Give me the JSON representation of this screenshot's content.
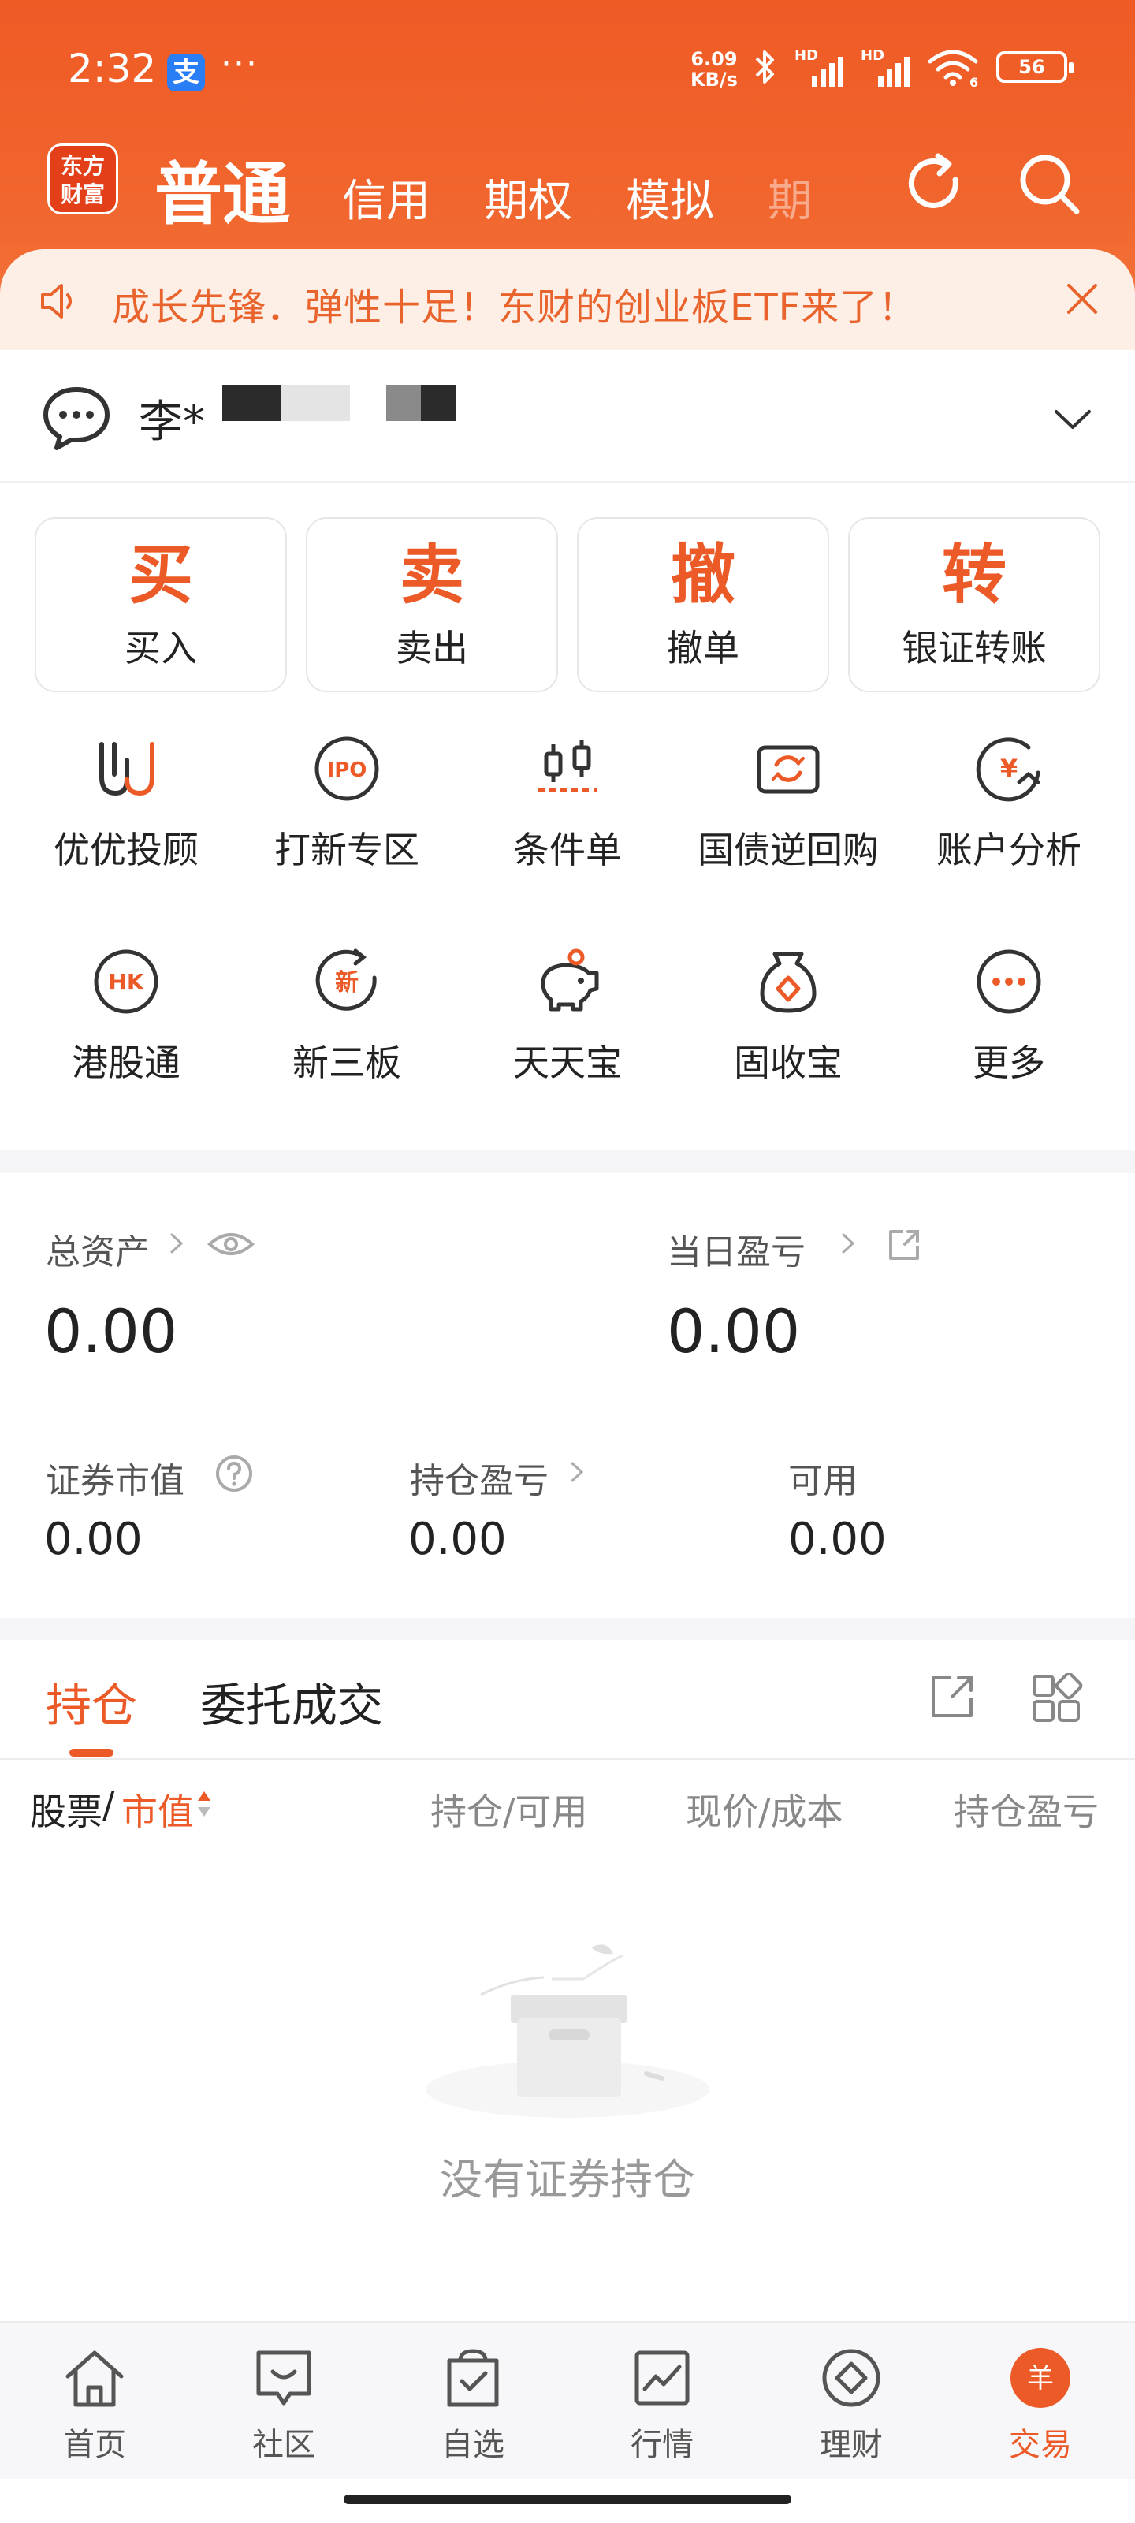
{
  "status_bar": {
    "time": "2:32",
    "app_badge": "支",
    "more": "···",
    "net_speed_value": "6.09",
    "net_speed_unit": "KB/s",
    "signal_1": "HD",
    "signal_2": "HD",
    "wifi_badge": "6",
    "battery": "56"
  },
  "header": {
    "brand": "东方财富",
    "brand_line1": "东方",
    "brand_line2": "财富",
    "tabs": [
      "普通",
      "信用",
      "期权",
      "模拟",
      "期"
    ],
    "active_tab": "普通"
  },
  "notice": {
    "text": "成长先锋．弹性十足！东财的创业板ETF来了！"
  },
  "account": {
    "name": "李*"
  },
  "main_actions": [
    {
      "big": "买",
      "label": "买入"
    },
    {
      "big": "卖",
      "label": "卖出"
    },
    {
      "big": "撤",
      "label": "撤单"
    },
    {
      "big": "转",
      "label": "银证转账"
    }
  ],
  "functions": [
    {
      "label": "优优投顾",
      "icon": "uu-advisor-icon"
    },
    {
      "label": "打新专区",
      "icon": "ipo-icon",
      "icon_text": "IPO"
    },
    {
      "label": "条件单",
      "icon": "condition-order-icon"
    },
    {
      "label": "国债逆回购",
      "icon": "bond-repo-icon"
    },
    {
      "label": "账户分析",
      "icon": "account-analysis-icon",
      "icon_text": "¥"
    },
    {
      "label": "港股通",
      "icon": "hk-connect-icon",
      "icon_text": "HK"
    },
    {
      "label": "新三板",
      "icon": "new-third-board-icon",
      "icon_text": "新"
    },
    {
      "label": "天天宝",
      "icon": "piggy-bank-icon"
    },
    {
      "label": "固收宝",
      "icon": "money-bag-icon"
    },
    {
      "label": "更多",
      "icon": "more-icon"
    }
  ],
  "assets": {
    "total_label": "总资产",
    "total_value": "0.00",
    "daily_pl_label": "当日盈亏",
    "daily_pl_value": "0.00",
    "market_value_label": "证券市值",
    "market_value": "0.00",
    "position_pl_label": "持仓盈亏",
    "position_pl_value": "0.00",
    "available_label": "可用",
    "available_value": "0.00"
  },
  "positions": {
    "tabs": [
      "持仓",
      "委托成交"
    ],
    "columns": {
      "stock": "股票",
      "separator": "/",
      "market_value": "市值",
      "hold_available": "持仓/可用",
      "price_cost": "现价/成本",
      "hold_pl": "持仓盈亏"
    },
    "empty_text": "没有证券持仓"
  },
  "bottom_nav": [
    {
      "label": "首页",
      "icon": "home-icon"
    },
    {
      "label": "社区",
      "icon": "community-icon"
    },
    {
      "label": "自选",
      "icon": "watchlist-icon"
    },
    {
      "label": "行情",
      "icon": "market-icon"
    },
    {
      "label": "理财",
      "icon": "wealth-icon"
    },
    {
      "label": "交易",
      "icon": "trade-icon",
      "icon_text": "羊"
    }
  ],
  "colors": {
    "accent": "#ec5a28",
    "header": "#ef5a25",
    "notice_bg": "#fdeee6"
  }
}
